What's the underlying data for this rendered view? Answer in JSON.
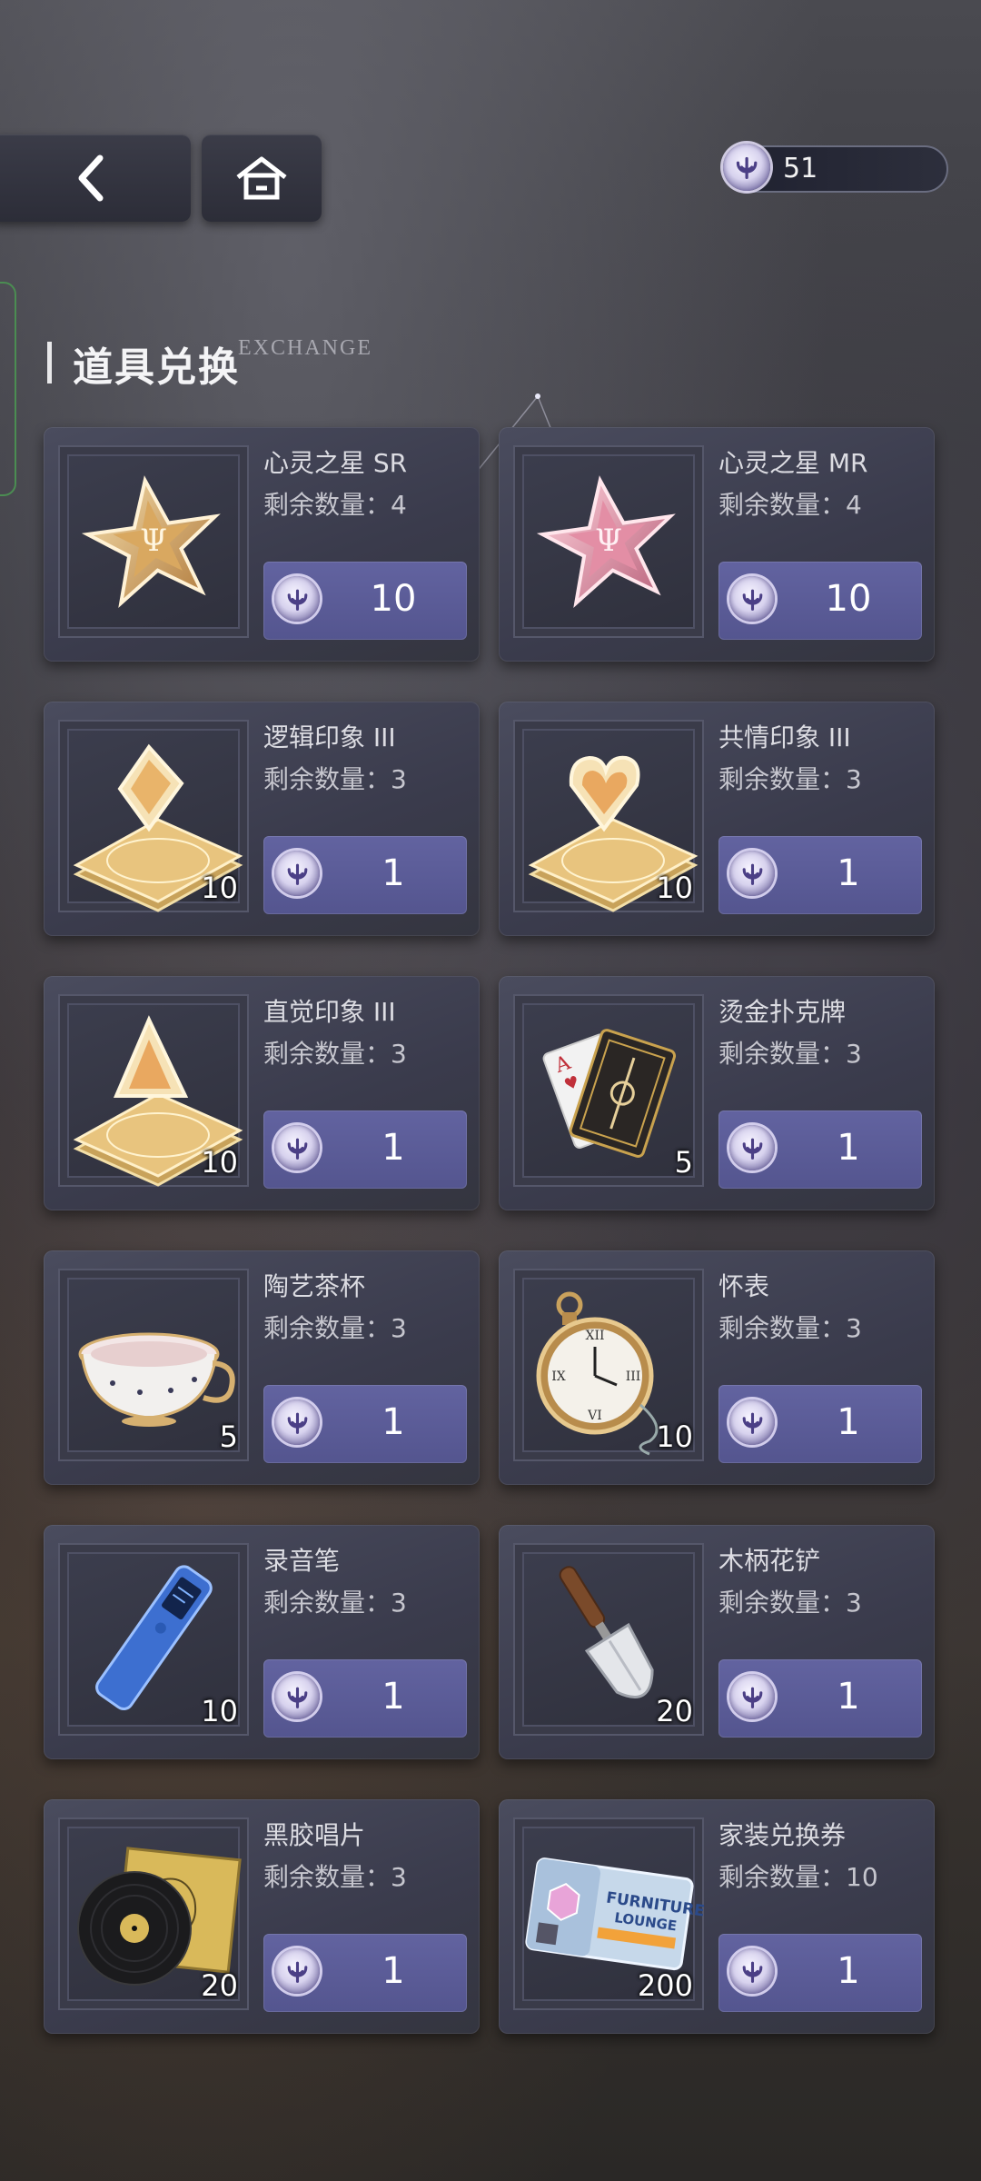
{
  "header": {
    "currency_value": "51",
    "section_title": "道具兑换",
    "section_subtitle": "EXCHANGE"
  },
  "items": [
    {
      "name": "心灵之星 SR",
      "remaining": "剩余数量：4",
      "price": "10",
      "quantity": "",
      "icon": "star-badge-gold-icon"
    },
    {
      "name": "心灵之星 MR",
      "remaining": "剩余数量：4",
      "price": "10",
      "quantity": "",
      "icon": "star-badge-pink-icon"
    },
    {
      "name": "逻辑印象 III",
      "remaining": "剩余数量：3",
      "price": "1",
      "quantity": "10",
      "icon": "diamond-crystal-icon"
    },
    {
      "name": "共情印象 III",
      "remaining": "剩余数量：3",
      "price": "1",
      "quantity": "10",
      "icon": "heart-crystal-icon"
    },
    {
      "name": "直觉印象 III",
      "remaining": "剩余数量：3",
      "price": "1",
      "quantity": "10",
      "icon": "pyramid-crystal-icon"
    },
    {
      "name": "烫金扑克牌",
      "remaining": "剩余数量：3",
      "price": "1",
      "quantity": "5",
      "icon": "playing-cards-icon"
    },
    {
      "name": "陶艺茶杯",
      "remaining": "剩余数量：3",
      "price": "1",
      "quantity": "5",
      "icon": "teacup-icon"
    },
    {
      "name": "怀表",
      "remaining": "剩余数量：3",
      "price": "1",
      "quantity": "10",
      "icon": "pocket-watch-icon"
    },
    {
      "name": "录音笔",
      "remaining": "剩余数量：3",
      "price": "1",
      "quantity": "10",
      "icon": "voice-recorder-icon"
    },
    {
      "name": "木柄花铲",
      "remaining": "剩余数量：3",
      "price": "1",
      "quantity": "20",
      "icon": "garden-trowel-icon"
    },
    {
      "name": "黑胶唱片",
      "remaining": "剩余数量：3",
      "price": "1",
      "quantity": "20",
      "icon": "vinyl-record-icon"
    },
    {
      "name": "家装兑换券",
      "remaining": "剩余数量：10",
      "price": "1",
      "quantity": "200",
      "icon": "furniture-voucher-icon"
    }
  ],
  "voucher_text": {
    "line1": "FURNITURE",
    "line2": "LOUNGE"
  },
  "colors": {
    "button": "#5a5b96",
    "card": "#3e3f50",
    "currency_border": "#6a6d80"
  }
}
